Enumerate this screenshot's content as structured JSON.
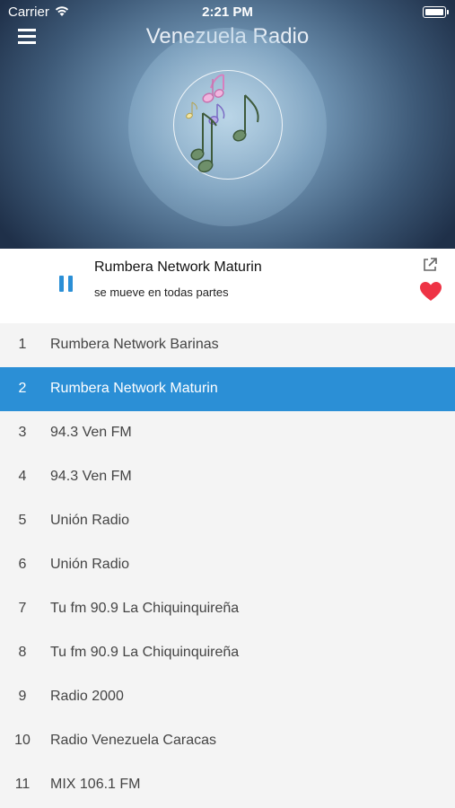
{
  "status_bar": {
    "carrier": "Carrier",
    "time": "2:21 PM"
  },
  "header": {
    "title": "Venezuela Radio",
    "menu_icon": "hamburger-menu-icon"
  },
  "player": {
    "now_playing_title": "Rumbera Network Maturin",
    "now_playing_subtitle": "se mueve en todas partes",
    "state_icon": "pause-icon",
    "share_icon": "share-external-icon",
    "favorite_icon": "heart-icon",
    "accent_color": "#2b8fd6",
    "favorite_color": "#ee3345"
  },
  "stations": [
    {
      "num": "1",
      "name": "Rumbera Network Barinas"
    },
    {
      "num": "2",
      "name": "Rumbera Network Maturin",
      "selected": true
    },
    {
      "num": "3",
      "name": "94.3 Ven FM"
    },
    {
      "num": "4",
      "name": "94.3 Ven FM"
    },
    {
      "num": "5",
      "name": "Unión Radio"
    },
    {
      "num": "6",
      "name": "Unión Radio"
    },
    {
      "num": "7",
      "name": "Tu fm 90.9 La Chiquinquireña"
    },
    {
      "num": "8",
      "name": "Tu fm 90.9 La Chiquinquireña"
    },
    {
      "num": "9",
      "name": "Radio 2000"
    },
    {
      "num": "10",
      "name": "Radio Venezuela Caracas"
    },
    {
      "num": "11",
      "name": "MIX 106.1 FM"
    }
  ]
}
